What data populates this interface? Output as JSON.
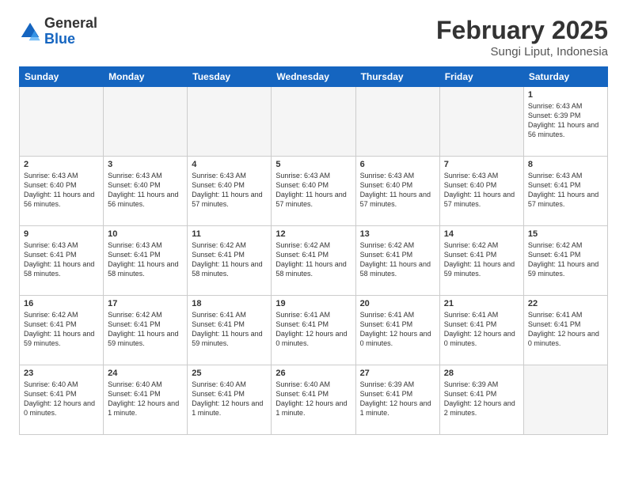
{
  "header": {
    "logo": {
      "general": "General",
      "blue": "Blue"
    },
    "title": "February 2025",
    "location": "Sungi Liput, Indonesia"
  },
  "days_of_week": [
    "Sunday",
    "Monday",
    "Tuesday",
    "Wednesday",
    "Thursday",
    "Friday",
    "Saturday"
  ],
  "weeks": [
    [
      {
        "day": "",
        "empty": true
      },
      {
        "day": "",
        "empty": true
      },
      {
        "day": "",
        "empty": true
      },
      {
        "day": "",
        "empty": true
      },
      {
        "day": "",
        "empty": true
      },
      {
        "day": "",
        "empty": true
      },
      {
        "day": "1",
        "sunrise": "6:43 AM",
        "sunset": "6:39 PM",
        "daylight": "11 hours and 56 minutes."
      }
    ],
    [
      {
        "day": "2",
        "sunrise": "6:43 AM",
        "sunset": "6:40 PM",
        "daylight": "11 hours and 56 minutes."
      },
      {
        "day": "3",
        "sunrise": "6:43 AM",
        "sunset": "6:40 PM",
        "daylight": "11 hours and 56 minutes."
      },
      {
        "day": "4",
        "sunrise": "6:43 AM",
        "sunset": "6:40 PM",
        "daylight": "11 hours and 57 minutes."
      },
      {
        "day": "5",
        "sunrise": "6:43 AM",
        "sunset": "6:40 PM",
        "daylight": "11 hours and 57 minutes."
      },
      {
        "day": "6",
        "sunrise": "6:43 AM",
        "sunset": "6:40 PM",
        "daylight": "11 hours and 57 minutes."
      },
      {
        "day": "7",
        "sunrise": "6:43 AM",
        "sunset": "6:40 PM",
        "daylight": "11 hours and 57 minutes."
      },
      {
        "day": "8",
        "sunrise": "6:43 AM",
        "sunset": "6:41 PM",
        "daylight": "11 hours and 57 minutes."
      }
    ],
    [
      {
        "day": "9",
        "sunrise": "6:43 AM",
        "sunset": "6:41 PM",
        "daylight": "11 hours and 58 minutes."
      },
      {
        "day": "10",
        "sunrise": "6:43 AM",
        "sunset": "6:41 PM",
        "daylight": "11 hours and 58 minutes."
      },
      {
        "day": "11",
        "sunrise": "6:42 AM",
        "sunset": "6:41 PM",
        "daylight": "11 hours and 58 minutes."
      },
      {
        "day": "12",
        "sunrise": "6:42 AM",
        "sunset": "6:41 PM",
        "daylight": "11 hours and 58 minutes."
      },
      {
        "day": "13",
        "sunrise": "6:42 AM",
        "sunset": "6:41 PM",
        "daylight": "11 hours and 58 minutes."
      },
      {
        "day": "14",
        "sunrise": "6:42 AM",
        "sunset": "6:41 PM",
        "daylight": "11 hours and 59 minutes."
      },
      {
        "day": "15",
        "sunrise": "6:42 AM",
        "sunset": "6:41 PM",
        "daylight": "11 hours and 59 minutes."
      }
    ],
    [
      {
        "day": "16",
        "sunrise": "6:42 AM",
        "sunset": "6:41 PM",
        "daylight": "11 hours and 59 minutes."
      },
      {
        "day": "17",
        "sunrise": "6:42 AM",
        "sunset": "6:41 PM",
        "daylight": "11 hours and 59 minutes."
      },
      {
        "day": "18",
        "sunrise": "6:41 AM",
        "sunset": "6:41 PM",
        "daylight": "11 hours and 59 minutes."
      },
      {
        "day": "19",
        "sunrise": "6:41 AM",
        "sunset": "6:41 PM",
        "daylight": "12 hours and 0 minutes."
      },
      {
        "day": "20",
        "sunrise": "6:41 AM",
        "sunset": "6:41 PM",
        "daylight": "12 hours and 0 minutes."
      },
      {
        "day": "21",
        "sunrise": "6:41 AM",
        "sunset": "6:41 PM",
        "daylight": "12 hours and 0 minutes."
      },
      {
        "day": "22",
        "sunrise": "6:41 AM",
        "sunset": "6:41 PM",
        "daylight": "12 hours and 0 minutes."
      }
    ],
    [
      {
        "day": "23",
        "sunrise": "6:40 AM",
        "sunset": "6:41 PM",
        "daylight": "12 hours and 0 minutes."
      },
      {
        "day": "24",
        "sunrise": "6:40 AM",
        "sunset": "6:41 PM",
        "daylight": "12 hours and 1 minute."
      },
      {
        "day": "25",
        "sunrise": "6:40 AM",
        "sunset": "6:41 PM",
        "daylight": "12 hours and 1 minute."
      },
      {
        "day": "26",
        "sunrise": "6:40 AM",
        "sunset": "6:41 PM",
        "daylight": "12 hours and 1 minute."
      },
      {
        "day": "27",
        "sunrise": "6:39 AM",
        "sunset": "6:41 PM",
        "daylight": "12 hours and 1 minute."
      },
      {
        "day": "28",
        "sunrise": "6:39 AM",
        "sunset": "6:41 PM",
        "daylight": "12 hours and 2 minutes."
      },
      {
        "day": "",
        "empty": true
      }
    ]
  ]
}
